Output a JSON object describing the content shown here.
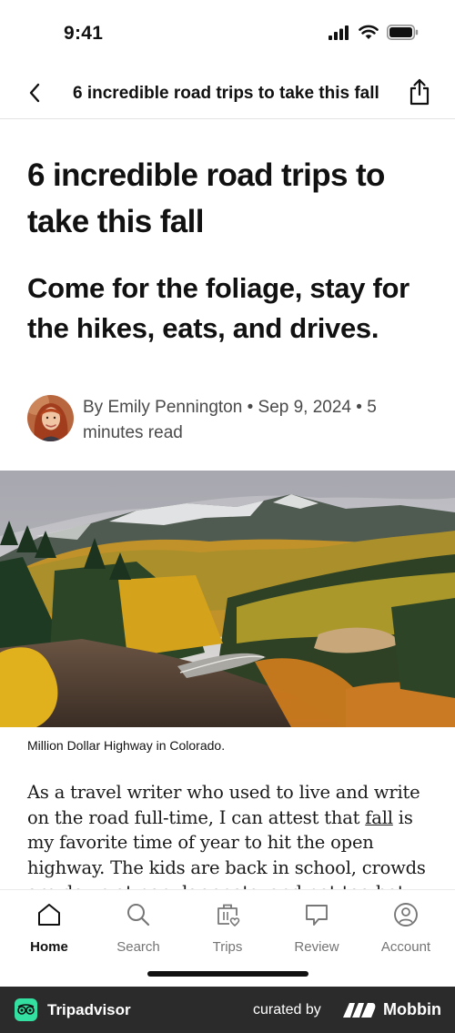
{
  "status_bar": {
    "time": "9:41"
  },
  "nav": {
    "title": "6 incredible road trips to take this fall"
  },
  "article": {
    "headline": "6 incredible road trips to take this fall",
    "subheadline": "Come for the foliage, stay for the hikes, eats, and drives.",
    "byline": "By Emily Pennington • Sep 9, 2024 • 5 minutes read",
    "caption": "Million Dollar Highway in Colorado.",
    "body_before": "As a travel writer who used to live and write on the road full-time, I can attest that ",
    "body_link": "fall",
    "body_after": " is my favorite time of year to hit the open highway. The kids are back in school, crowds are down at popular spots, and not-too-hot temperatures are ideal for hiking."
  },
  "tabs": [
    {
      "label": "Home",
      "icon": "home-icon",
      "active": true
    },
    {
      "label": "Search",
      "icon": "search-icon",
      "active": false
    },
    {
      "label": "Trips",
      "icon": "suitcase-heart-icon",
      "active": false
    },
    {
      "label": "Review",
      "icon": "speech-bubble-icon",
      "active": false
    },
    {
      "label": "Account",
      "icon": "user-circle-icon",
      "active": false
    }
  ],
  "footer": {
    "brand": "Tripadvisor",
    "curated_by": "curated by",
    "mobbin": "Mobbin"
  },
  "colors": {
    "tripadvisor_green": "#34e0a1",
    "footer_background": "#2b2b2b",
    "active_tab": "#111111",
    "inactive_tab": "#757575"
  }
}
